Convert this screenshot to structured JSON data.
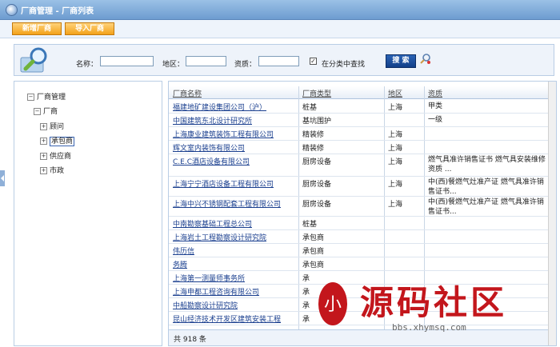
{
  "window": {
    "title": "厂商管理 - 厂商列表"
  },
  "toolbar": {
    "add_label": "新增厂商",
    "import_label": "导入厂商"
  },
  "search": {
    "name_label": "名称：",
    "region_label": "地区：",
    "qual_label": "资质：",
    "category_label": "在分类中查找",
    "category_checked": true,
    "checkmark": "✓",
    "button_label": "搜 索"
  },
  "tree": {
    "root": "厂商管理",
    "child": "厂商",
    "items": [
      "顾问",
      "承包商",
      "供应商",
      "市政"
    ],
    "selected": "承包商",
    "minus": "−",
    "plus": "+"
  },
  "table": {
    "headers": {
      "name": "厂商名称",
      "type": "厂商类型",
      "region": "地区",
      "qual": "资质"
    },
    "rows": [
      {
        "name": "福建地矿建设集团公司（沪）",
        "type": "桩基",
        "region": "上海",
        "qual": "甲类"
      },
      {
        "name": "中国建筑东北设计研究所",
        "type": "基坑围护",
        "region": "",
        "qual": "一级"
      },
      {
        "name": "上海康业建筑装饰工程有限公司",
        "type": "精装修",
        "region": "上海",
        "qual": ""
      },
      {
        "name": "辉文室内装饰有限公司",
        "type": "精装修",
        "region": "上海",
        "qual": ""
      },
      {
        "name": "C.E.C酒店设备有限公司",
        "type": "厨房设备",
        "region": "上海",
        "qual": "燃气具准许销售证书 燃气具安装维修资质 ..."
      },
      {
        "name": "上海宁宁酒店设备工程有限公司",
        "type": "厨房设备",
        "region": "上海",
        "qual": "中(西)餐燃气灶准产证 燃气具准许销售证书..."
      },
      {
        "name": "上海中兴不锈钢配套工程有限公司",
        "type": "厨房设备",
        "region": "上海",
        "qual": "中(西)餐燃气灶准产证 燃气具准许销售证书..."
      },
      {
        "name": "中南勘察基础工程总公司",
        "type": "桩基",
        "region": "",
        "qual": ""
      },
      {
        "name": "上海岩土工程勘察设计研究院",
        "type": "承包商",
        "region": "",
        "qual": ""
      },
      {
        "name": "伟历信",
        "type": "承包商",
        "region": "",
        "qual": ""
      },
      {
        "name": "务腾",
        "type": "承包商",
        "region": "",
        "qual": ""
      },
      {
        "name": "上海第一测量师事务所",
        "type": "承",
        "region": "",
        "qual": ""
      },
      {
        "name": "上海申都工程咨询有限公司",
        "type": "承",
        "region": "",
        "qual": ""
      },
      {
        "name": "中船勘察设计研究院",
        "type": "承",
        "region": "",
        "qual": ""
      },
      {
        "name": "昆山经济技术开发区建筑安装工程",
        "type": "承",
        "region": "",
        "qual": ""
      }
    ],
    "footer": "共 918 条"
  },
  "watermark": {
    "text": "源码社区",
    "url": "bbs.xhymsq.com",
    "logo_text": "小",
    "color": "#c3161c"
  }
}
